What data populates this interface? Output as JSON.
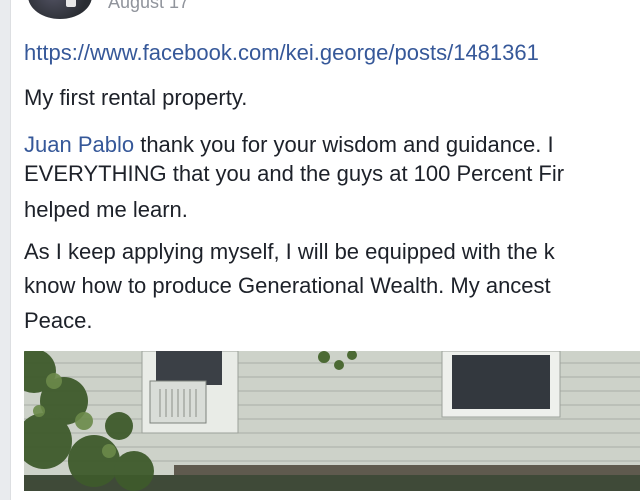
{
  "post": {
    "date": "August 17",
    "link": "https://www.facebook.com/kei.george/posts/1481361",
    "paragraph1": "My first rental property.",
    "mention": "Juan Pablo",
    "p2_line1_rest": " thank you for your wisdom and guidance. I",
    "p2_line2": "EVERYTHING that you and the guys at 100 Percent Fir",
    "p2_line3": "helped me learn.",
    "p3_line1": "As I keep applying myself, I will be equipped with the k",
    "p3_line2": "know how to produce Generational Wealth. My ancest",
    "p3_line3": "Peace."
  },
  "colors": {
    "link": "#365899",
    "text": "#1d2129",
    "meta": "#90949c"
  },
  "icons": {
    "avatar": "profile-photo"
  }
}
